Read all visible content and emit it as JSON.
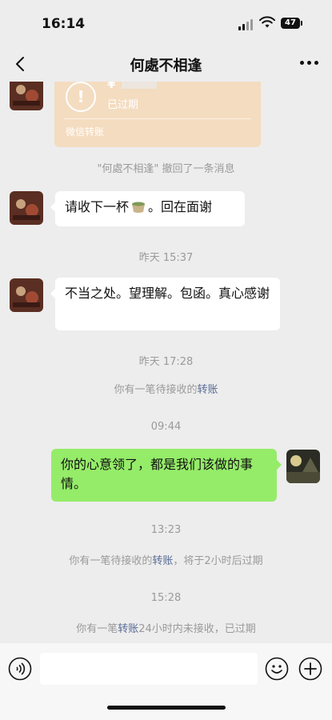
{
  "status_bar": {
    "time": "16:14",
    "battery": "47"
  },
  "nav": {
    "title": "何處不相逢",
    "back_icon": "chevron-left-icon",
    "more_icon": "more-dots-icon"
  },
  "transfer": {
    "currency": "¥",
    "status": "已过期",
    "label": "微信转账",
    "icon": "exclamation-circle-icon"
  },
  "messages": {
    "recall_notice": "\"何處不相逢\" 撤回了一条消息",
    "msg1_before": "请收下一杯",
    "msg1_after": "。回在面谢",
    "time1": "昨天 15:37",
    "msg2": "不当之处。望理解。包函。真心感谢",
    "time2": "昨天 17:28",
    "pending_text": "你有一笔待接收的",
    "transfer_link": "转账",
    "time3": "09:44",
    "reply": "你的心意领了，都是我们该做的事情。",
    "time4": "13:23",
    "pending2_text": "你有一笔待接收的",
    "pending2_link": "转账",
    "pending2_suffix": "，将于2小时后过期",
    "time5": "15:28",
    "expired_prefix": "你有一笔",
    "expired_link": "转账",
    "expired_suffix": "24小时内未接收，已过期"
  },
  "input_bar": {
    "voice_icon": "voice-icon",
    "emoji_icon": "emoji-icon",
    "plus_icon": "plus-circle-icon",
    "placeholder": ""
  },
  "colors": {
    "background": "#ededed",
    "bubble_self": "#95ec69",
    "bubble_other": "#ffffff",
    "transfer_card": "#f4dcc0",
    "link": "#576b95",
    "system_text": "#9a9a9a"
  }
}
